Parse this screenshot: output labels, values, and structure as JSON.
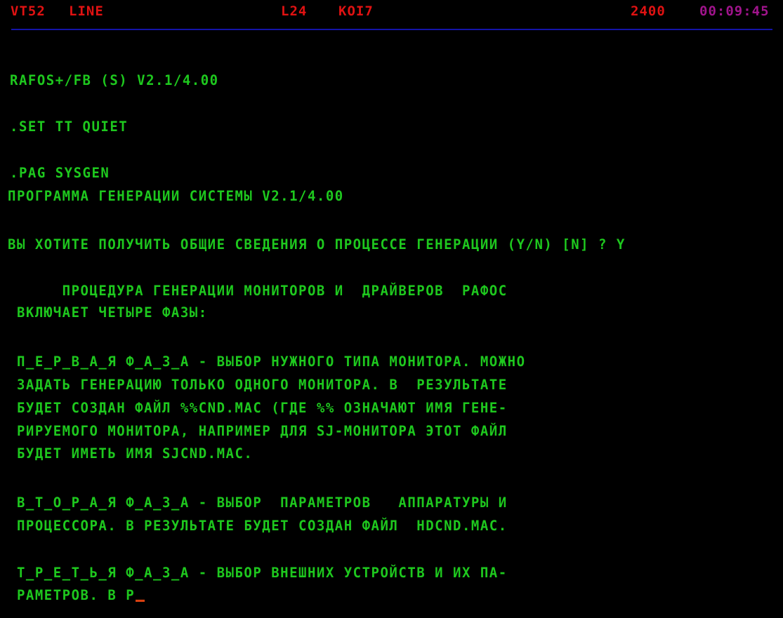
{
  "status_bar": {
    "terminal": "VT52",
    "mode": "LINE",
    "lines": "L24",
    "charset": "KOI7",
    "baud": "2400",
    "clock": "00:09:45",
    "colors": {
      "labels": "#e01212",
      "clock": "#a0148c",
      "divider": "#1414a8"
    }
  },
  "screen": {
    "text_color": "#1ec81e",
    "cursor_color": "#d84010",
    "lines": [
      {
        "text": "RAFOS+/FB (S) V2.1/4.00"
      },
      {
        "text": ".SET TT QUIET"
      },
      {
        "text": ".PAG SYSGEN"
      },
      {
        "text": "ПРОГРАММА ГЕНЕРАЦИИ СИСТЕМЫ V2.1/4.00"
      },
      {
        "text": "ВЫ ХОТИТЕ ПОЛУЧИТЬ ОБЩИЕ СВЕДЕНИЯ О ПРОЦЕССЕ ГЕНЕРАЦИИ (Y/N) [N] ? Y"
      },
      {
        "text": "      ПРОЦЕДУРА ГЕНЕРАЦИИ МОНИТОРОВ И  ДРАЙВЕРОВ  РАФОС"
      },
      {
        "text": " ВКЛЮЧАЕТ ЧЕТЫРЕ ФАЗЫ:"
      },
      {
        "text": " П_Е_Р_В_А_Я Ф_А_З_А - ВЫБОР НУЖНОГО ТИПА МОНИТОРА. МОЖНО"
      },
      {
        "text": " ЗАДАТЬ ГЕНЕРАЦИЮ ТОЛЬКО ОДНОГО МОНИТОРА. В  РЕЗУЛЬТАТЕ"
      },
      {
        "text": " БУДЕТ СОЗДАН ФАЙЛ %%CND.MAC (ГДЕ %% ОЗНАЧАЮТ ИМЯ ГЕНЕ-"
      },
      {
        "text": " РИРУЕМОГО МОНИТОРА, НАПРИМЕР ДЛЯ SJ-МОНИТОРА ЭТОТ ФАЙЛ"
      },
      {
        "text": " БУДЕТ ИМЕТЬ ИМЯ SJCND.MAC."
      },
      {
        "text": " В_Т_О_Р_А_Я Ф_А_З_А - ВЫБОР  ПАРАМЕТРОВ   АППАРАТУРЫ И"
      },
      {
        "text": " ПРОЦЕССОРА. В РЕЗУЛЬТАТЕ БУДЕТ СОЗДАН ФАЙЛ  HDCND.MAC."
      },
      {
        "text": " Т_Р_Е_Т_Ь_Я Ф_А_З_А - ВЫБОР ВНЕШНИХ УСТРОЙСТВ И ИХ ПА-"
      },
      {
        "text": " РАМЕТРОВ. В Р"
      }
    ]
  }
}
